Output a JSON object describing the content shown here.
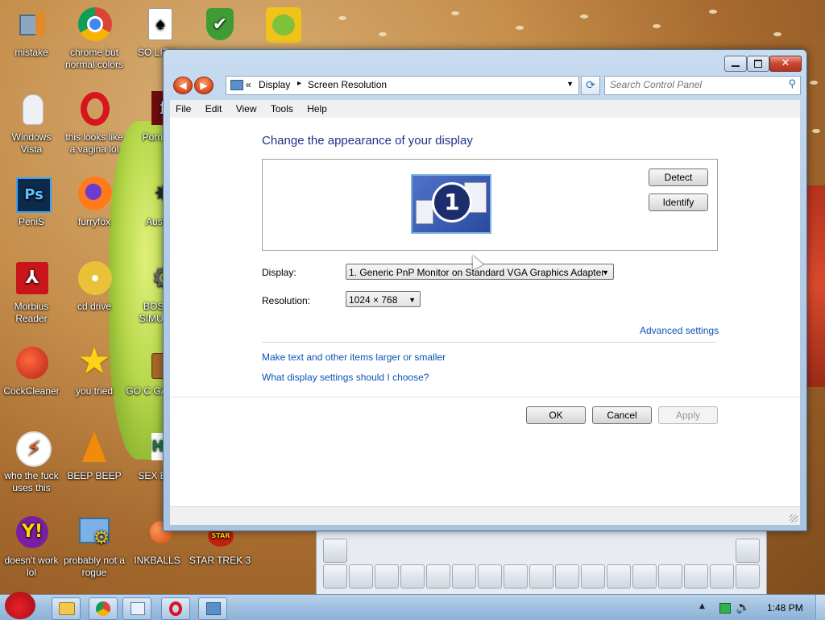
{
  "desktop": {
    "icons": [
      {
        "label": "mistake"
      },
      {
        "label": "chrome but normal colors"
      },
      {
        "label": "SO LIT!!!"
      },
      {
        "label": ""
      },
      {
        "label": ""
      },
      {
        "label": "Windows Vista"
      },
      {
        "label": "this looks like a vagina lol"
      },
      {
        "label": "Porn P"
      },
      {
        "label": "PeniS"
      },
      {
        "label": "furryfox"
      },
      {
        "label": "Austr"
      },
      {
        "label": "Morbius Reader"
      },
      {
        "label": "cd drive"
      },
      {
        "label": "BOSN SIMULA"
      },
      {
        "label": "CockCleaner"
      },
      {
        "label": "you tried"
      },
      {
        "label": "GO C GADGE"
      },
      {
        "label": "who the fuck uses this"
      },
      {
        "label": "BEEP BEEP"
      },
      {
        "label": "SEX EDI"
      },
      {
        "label": "doesn't work lol"
      },
      {
        "label": "probably not a rogue"
      },
      {
        "label": "INKBALLS"
      },
      {
        "label": "STAR TREK 3"
      }
    ]
  },
  "window": {
    "address": {
      "chevrons": "«",
      "crumb1": "Display",
      "crumb_sep": "▸",
      "crumb2": "Screen Resolution"
    },
    "search": {
      "placeholder": "Search Control Panel"
    },
    "menu": {
      "file": "File",
      "edit": "Edit",
      "view": "View",
      "tools": "Tools",
      "help": "Help"
    },
    "content": {
      "heading": "Change the appearance of your display",
      "monitor_number": "1",
      "detect_label": "Detect",
      "identify_label": "Identify",
      "display_label": "Display:",
      "display_value": "1. Generic PnP Monitor on Standard VGA Graphics Adapter",
      "resolution_label": "Resolution:",
      "resolution_value": "1024 × 768",
      "advanced_link": "Advanced settings",
      "text_size_link": "Make text and other items larger or smaller",
      "help_link": "What display settings should I choose?",
      "ok_label": "OK",
      "cancel_label": "Cancel",
      "apply_label": "Apply"
    }
  },
  "taskbar": {
    "clock": "1:48 PM"
  },
  "colors": {
    "heading": "#1e3287",
    "link": "#0b54b4",
    "titlebar": "#b4cce6",
    "taskbar": "#9fbfe0"
  }
}
